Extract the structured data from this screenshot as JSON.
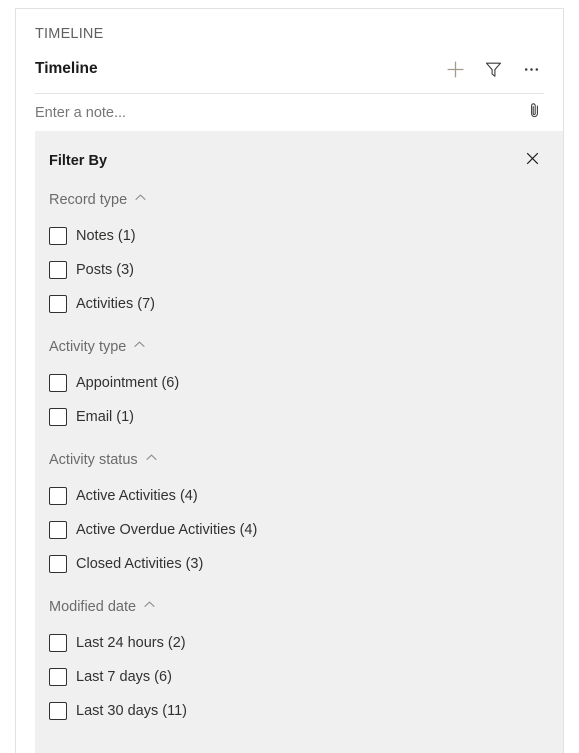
{
  "panel": {
    "section_label": "TIMELINE",
    "title": "Timeline",
    "commands": [
      {
        "name": "add-icon",
        "label": "Add"
      },
      {
        "name": "filter-icon",
        "label": "Filter"
      },
      {
        "name": "more-commands-icon",
        "label": "More commands"
      }
    ]
  },
  "note": {
    "placeholder": "Enter a note...",
    "value": "",
    "attach_label": "Attach"
  },
  "filter": {
    "title": "Filter By",
    "close_label": "Close",
    "groups": [
      {
        "title": "Record type",
        "expanded": true,
        "options": [
          {
            "label": "Notes (1)",
            "checked": false
          },
          {
            "label": "Posts (3)",
            "checked": false
          },
          {
            "label": "Activities (7)",
            "checked": false
          }
        ]
      },
      {
        "title": "Activity type",
        "expanded": true,
        "options": [
          {
            "label": "Appointment (6)",
            "checked": false
          },
          {
            "label": "Email (1)",
            "checked": false
          }
        ]
      },
      {
        "title": "Activity status",
        "expanded": true,
        "options": [
          {
            "label": "Active Activities (4)",
            "checked": false
          },
          {
            "label": "Active Overdue Activities (4)",
            "checked": false
          },
          {
            "label": "Closed Activities (3)",
            "checked": false
          }
        ]
      },
      {
        "title": "Modified date",
        "expanded": true,
        "options": [
          {
            "label": "Last 24 hours (2)",
            "checked": false
          },
          {
            "label": "Last 7 days (6)",
            "checked": false
          },
          {
            "label": "Last 30 days (11)",
            "checked": false
          }
        ]
      }
    ]
  },
  "colors": {
    "panel_bg": "#ffffff",
    "filter_bg": "#f0f0f0",
    "text_primary": "#323130",
    "text_secondary": "#6b6b6b",
    "border": "#e1e1e1",
    "add_icon": "#8a8886"
  }
}
